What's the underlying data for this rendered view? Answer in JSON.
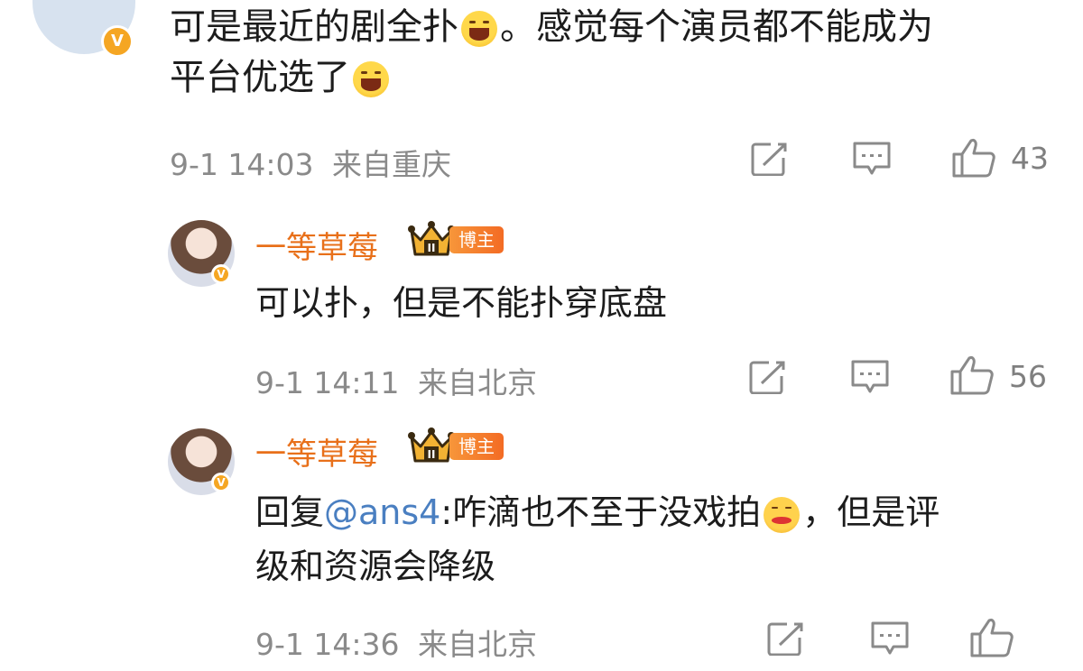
{
  "comment": {
    "text_line1_a": "可是最近的剧全扑",
    "text_line1_b": "。感觉每个演员都不能成为",
    "text_line2": "平台优选了",
    "emoji": "grinning-emoji",
    "time": "9-1 14:03",
    "location": "来自重庆",
    "likes": "43"
  },
  "replies": [
    {
      "username": "一等草莓",
      "tag": "博主",
      "rank": "II",
      "text": "可以扑，但是不能扑穿底盘",
      "time": "9-1 14:11",
      "location": "来自北京",
      "likes": "56"
    },
    {
      "username": "一等草莓",
      "tag": "博主",
      "rank": "II",
      "reply_prefix": "回复",
      "mention": "@ans4",
      "text_a": ":咋滴也不至于没戏拍",
      "text_b": "，但是评",
      "text_line2": "级和资源会降级",
      "emoji": "drooling-emoji",
      "time": "9-1 14:36",
      "location": "来自北京"
    }
  ],
  "verified_badge": "V",
  "colors": {
    "username": "#e8701a",
    "mention": "#4a7fc1",
    "meta": "#8a8a8a",
    "badge": "#f5a623"
  },
  "icons": [
    "share-icon",
    "comment-icon",
    "like-icon"
  ]
}
